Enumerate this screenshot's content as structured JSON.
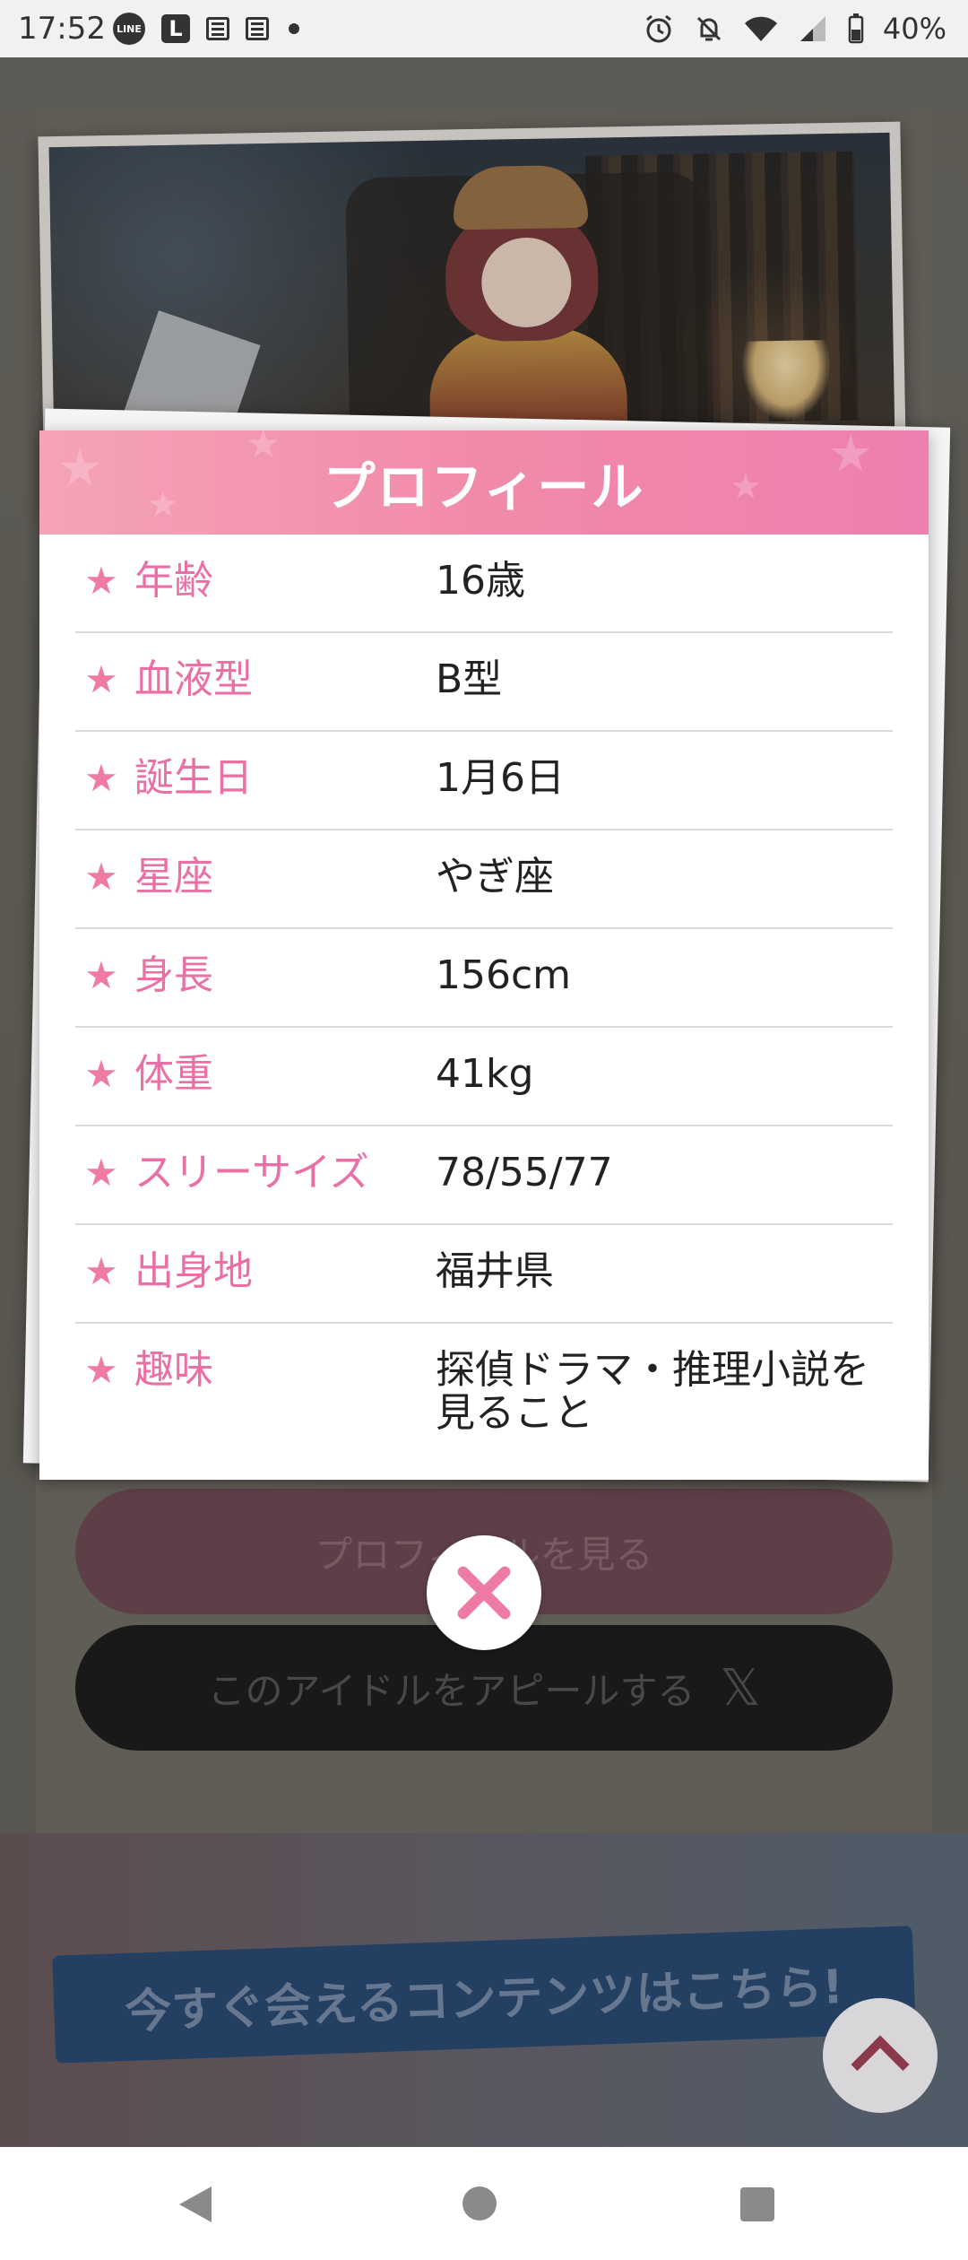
{
  "status_bar": {
    "time": "17:52",
    "battery": "40%",
    "icons": [
      "line-icon",
      "l-app-icon",
      "news-icon",
      "news-icon",
      "dot-icon",
      "alarm-icon",
      "bell-off-icon",
      "wifi-icon",
      "signal-icon",
      "battery-icon"
    ]
  },
  "background": {
    "profile_button": "プロフィールを見る",
    "appeal_button": "このアイドルをアピールする",
    "banner_text": "今すぐ会えるコンテンツはこちら!"
  },
  "modal": {
    "title": "プロフィール",
    "rows": [
      {
        "label": "年齢",
        "value": "16歳"
      },
      {
        "label": "血液型",
        "value": "B型"
      },
      {
        "label": "誕生日",
        "value": "1月6日"
      },
      {
        "label": "星座",
        "value": "やぎ座"
      },
      {
        "label": "身長",
        "value": "156cm"
      },
      {
        "label": "体重",
        "value": "41kg"
      },
      {
        "label": "スリーサイズ",
        "value": "78/55/77"
      },
      {
        "label": "出身地",
        "value": "福井県"
      },
      {
        "label": "趣味",
        "value": "探偵ドラマ・推理小説を見ること"
      }
    ]
  },
  "colors": {
    "accent_pink": "#ea6fa5",
    "header_pink": "#f18aa8",
    "star_pink": "#ef7aa2"
  }
}
